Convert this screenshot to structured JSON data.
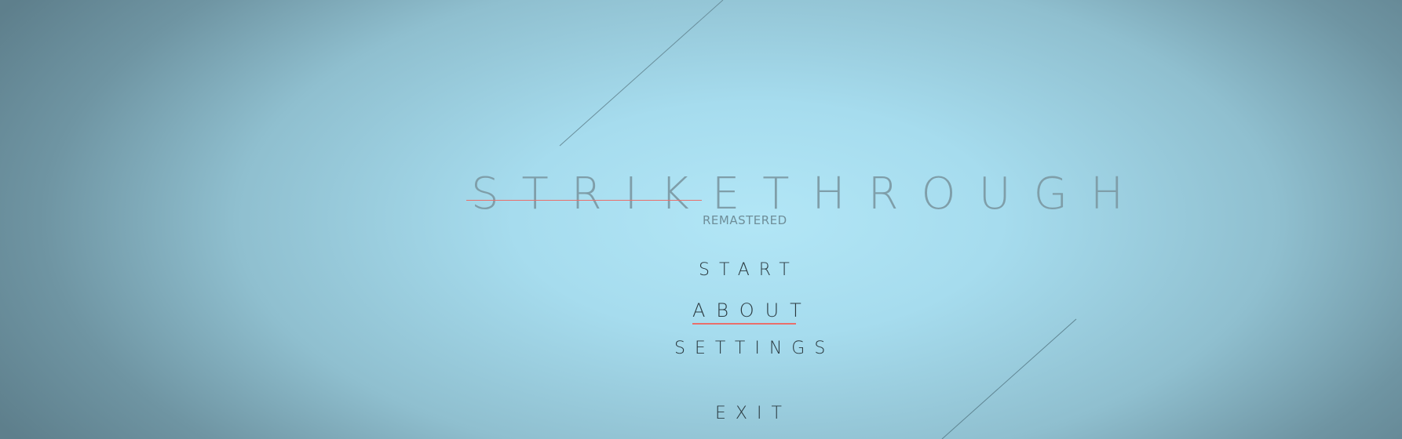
{
  "title": {
    "main": "STRIKETHROUGH",
    "subtitle": "REMASTERED"
  },
  "menu": {
    "start": "START",
    "about": "ABOUT",
    "settings": "SETTINGS",
    "exit": "EXIT",
    "selected": "about"
  },
  "colors": {
    "accent": "#e96f6b",
    "title": "#7f9ea9",
    "menu_text": "#2b3a40",
    "background_center": "#b2e6f6",
    "background_edge": "#5e7f8c"
  }
}
